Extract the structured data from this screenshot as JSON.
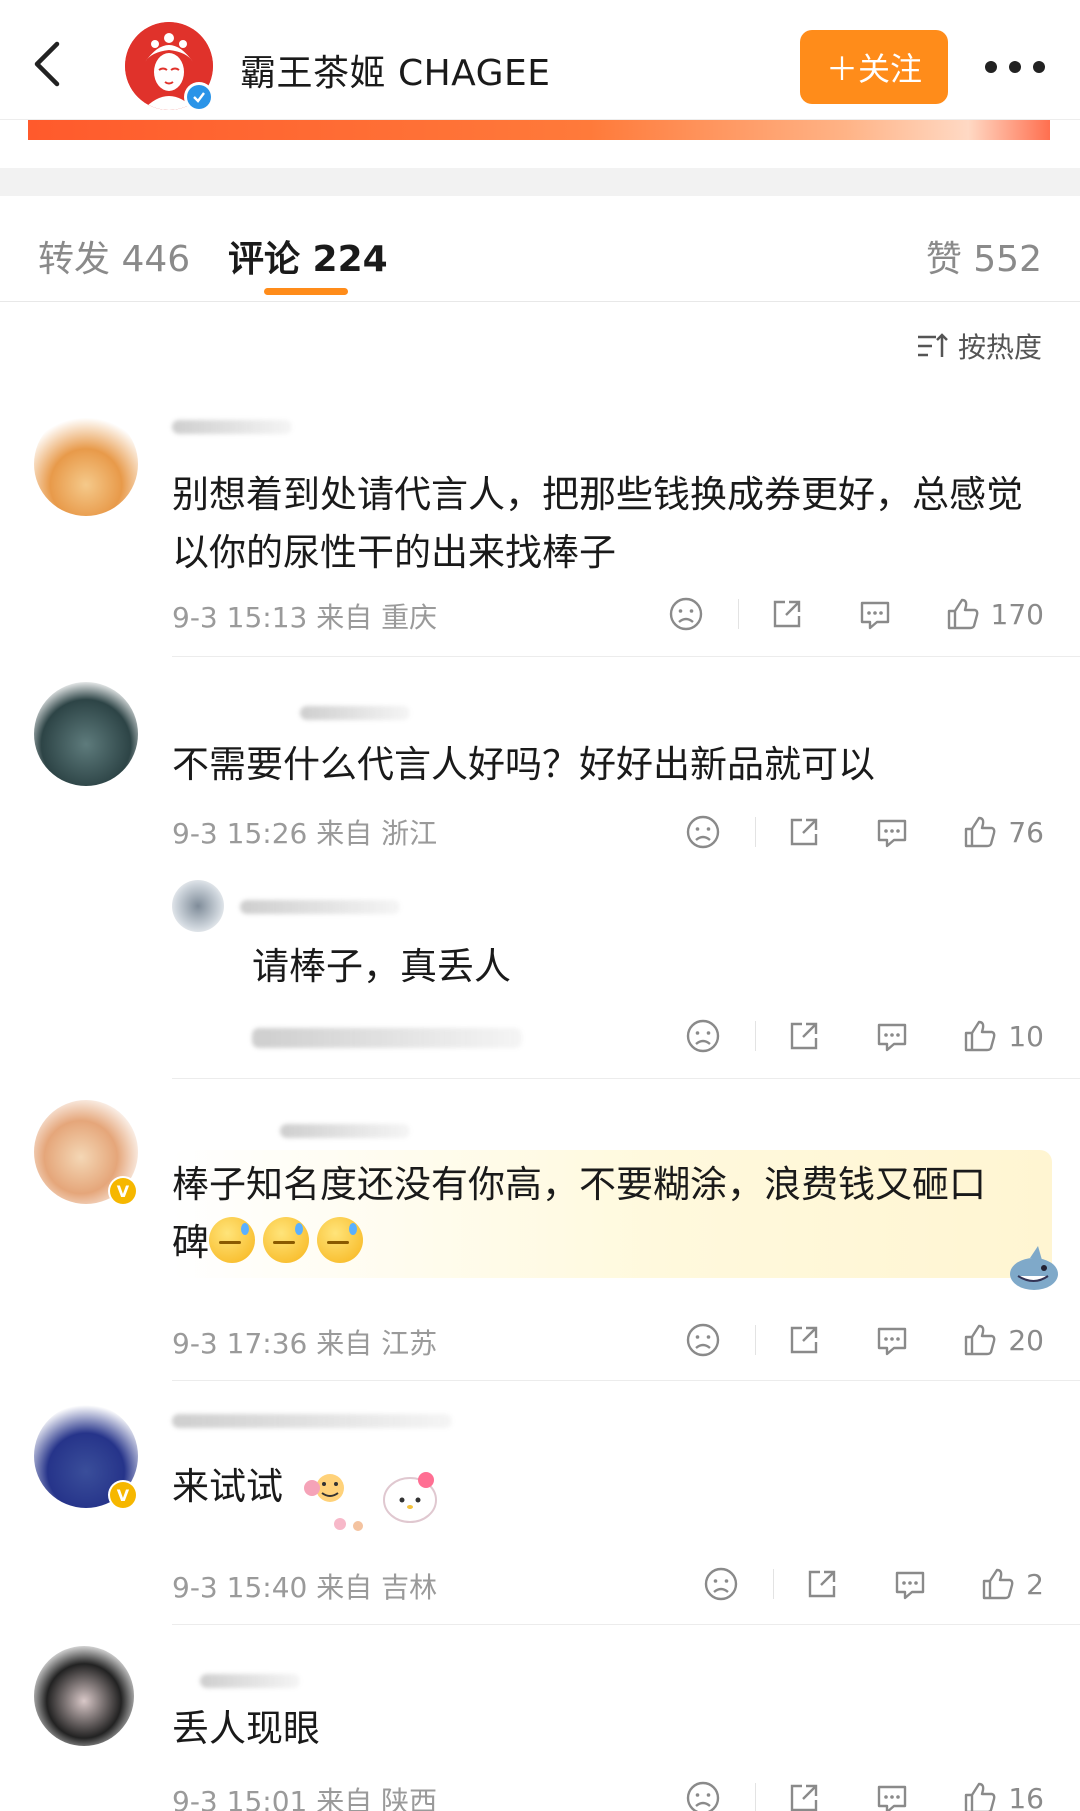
{
  "header": {
    "account_name": "霸王茶姬 CHAGEE",
    "follow_label": "＋关注"
  },
  "tabs": [
    {
      "label": "转发 446"
    },
    {
      "label": "评论 224",
      "active": true
    },
    {
      "label": "赞 552"
    }
  ],
  "sort_label": "按热度",
  "colors": {
    "accent": "#ff8c1a",
    "verified_blue": "#2a94e8",
    "verified_gold": "#f6b700"
  },
  "comments": [
    {
      "text": "别想着到处请代言人，把那些钱换成券更好，总感觉以你的尿性干的出来找棒子",
      "meta": "9-3 15:13 来自 重庆",
      "likes": "170"
    },
    {
      "text": "不需要什么代言人好吗？好好出新品就可以",
      "meta": "9-3 15:26 来自 浙江",
      "likes": "76"
    },
    {
      "text": "请棒子，真丢人",
      "meta": "",
      "likes": "10"
    },
    {
      "text": "棒子知名度还没有你高，不要糊涂，浪费钱又砸口碑",
      "meta": "9-3 17:36 来自 江苏",
      "likes": "20"
    },
    {
      "text": "来试试",
      "meta": "9-3 15:40 来自 吉林",
      "likes": "2"
    },
    {
      "text": "丢人现眼",
      "meta": "9-3 15:01 来自 陕西",
      "likes": "16"
    }
  ],
  "icons": [
    "back-arrow-icon",
    "more-icon",
    "sort-icon",
    "dislike-face-icon",
    "share-icon",
    "comment-icon",
    "thumb-up-icon"
  ]
}
